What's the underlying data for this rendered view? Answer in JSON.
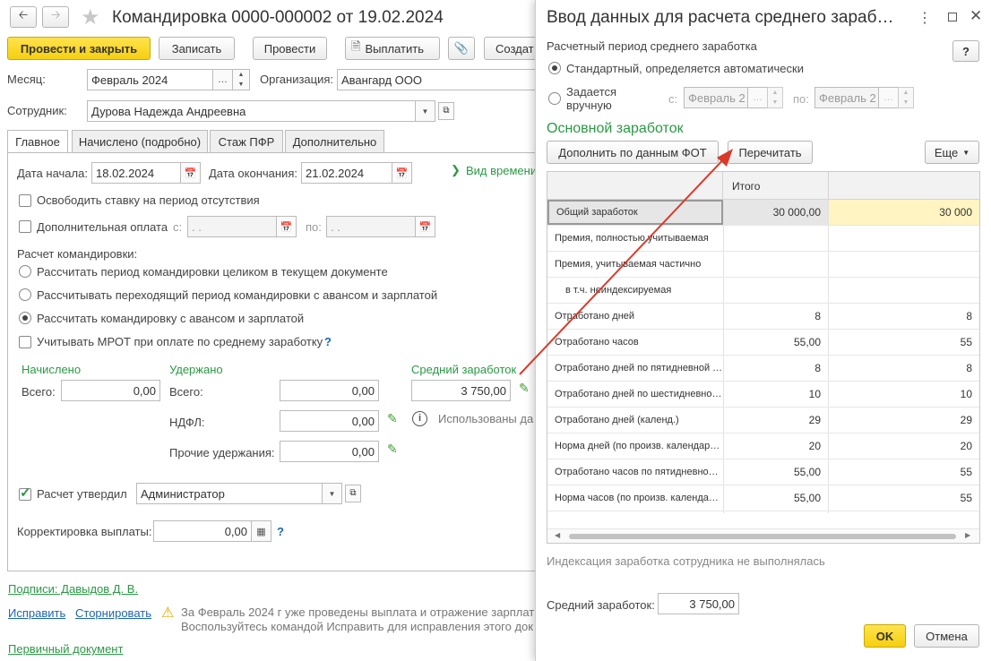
{
  "doc": {
    "title": "Командировка 0000-000002 от 19.02.2024",
    "toolbar": {
      "post_close": "Провести и закрыть",
      "save": "Записать",
      "post": "Провести",
      "pay": "Выплатить",
      "create": "Создат"
    },
    "month_label": "Месяц:",
    "month_value": "Февраль 2024",
    "org_label": "Организация:",
    "org_value": "Авангард ООО",
    "employee_label": "Сотрудник:",
    "employee_value": "Дурова Надежда Андреевна",
    "tabs": [
      "Главное",
      "Начислено (подробно)",
      "Стаж ПФР",
      "Дополнительно"
    ],
    "start_label": "Дата начала:",
    "start_value": "18.02.2024",
    "end_label": "Дата окончания:",
    "end_value": "21.02.2024",
    "time_type_link": "Вид времени",
    "release_rate": "Освободить ставку на период отсутствия",
    "extra_pay": "Дополнительная оплата",
    "extra_from": "с:",
    "extra_to": "по:",
    "date_placeholder": " .  .",
    "calc_label": "Расчет командировки:",
    "calc_options": [
      "Рассчитать период командировки целиком в текущем документе",
      "Рассчитывать переходящий период командировки с авансом и зарплатой",
      "Рассчитать командировку с авансом и зарплатой"
    ],
    "mrot": "Учитывать МРОТ при оплате по среднему заработку",
    "help": "?",
    "accrued_head": "Начислено",
    "withheld_head": "Удержано",
    "avg_head": "Средний заработок",
    "total_label": "Всего:",
    "accrued_total": "0,00",
    "withheld_total": "0,00",
    "ndfl_label": "НДФЛ:",
    "ndfl_value": "0,00",
    "other_label": "Прочие удержания:",
    "other_value": "0,00",
    "avg_value": "3 750,00",
    "used_data": "Использованы да",
    "approved_label": "Расчет утвердил",
    "approved_value": "Администратор",
    "correction_label": "Корректировка выплаты:",
    "correction_value": "0,00",
    "signatures": "Подписи: Давыдов Д. В.",
    "fix_link": "Исправить",
    "reverse_link": "Сторнировать",
    "warning_line1": "За Февраль 2024 г уже проведены выплата и отражение зарплат",
    "warning_line2": "Воспользуйтесь командой Исправить для исправления этого док",
    "primary_doc": "Первичный документ"
  },
  "dialog": {
    "title": "Ввод данных для расчета среднего зараб…",
    "period_label": "Расчетный период среднего заработка",
    "help": "?",
    "standard": "Стандартный, определяется автоматически",
    "manual_line1": "Задается",
    "manual_line2": "вручную",
    "from_label": "с:",
    "from_value": "Февраль 2",
    "to_label": "по:",
    "to_value": "Февраль 2",
    "section": "Основной заработок",
    "fill_btn": "Дополнить по данным ФОТ",
    "recalc_btn": "Перечитать",
    "more_btn": "Еще",
    "grid_header": "Итого",
    "rows": [
      {
        "name": "Общий заработок",
        "total": "30 000,00",
        "col": "30 000"
      },
      {
        "name": "Премия, полностью учитываемая",
        "total": "",
        "col": ""
      },
      {
        "name": "Премия, учитываемая частично",
        "total": "",
        "col": ""
      },
      {
        "name": "в т.ч. неиндексируемая",
        "total": "",
        "col": ""
      },
      {
        "name": "Отработано дней",
        "total": "8",
        "col": "8"
      },
      {
        "name": "Отработано часов",
        "total": "55,00",
        "col": "55"
      },
      {
        "name": "Отработано дней по пятидневной …",
        "total": "8",
        "col": "8"
      },
      {
        "name": "Отработано дней по шестидневно…",
        "total": "10",
        "col": "10"
      },
      {
        "name": "Отработано дней (календ.)",
        "total": "29",
        "col": "29"
      },
      {
        "name": "Норма дней (по произв. календар…",
        "total": "20",
        "col": "20"
      },
      {
        "name": "Отработано часов по пятидневно…",
        "total": "55,00",
        "col": "55"
      },
      {
        "name": "Норма часов (по произв. календа…",
        "total": "55,00",
        "col": "55"
      }
    ],
    "indexation": "Индексация заработка сотрудника не выполнялась",
    "avg_label": "Средний заработок:",
    "avg_value": "3 750,00",
    "ok": "OK",
    "cancel": "Отмена"
  }
}
